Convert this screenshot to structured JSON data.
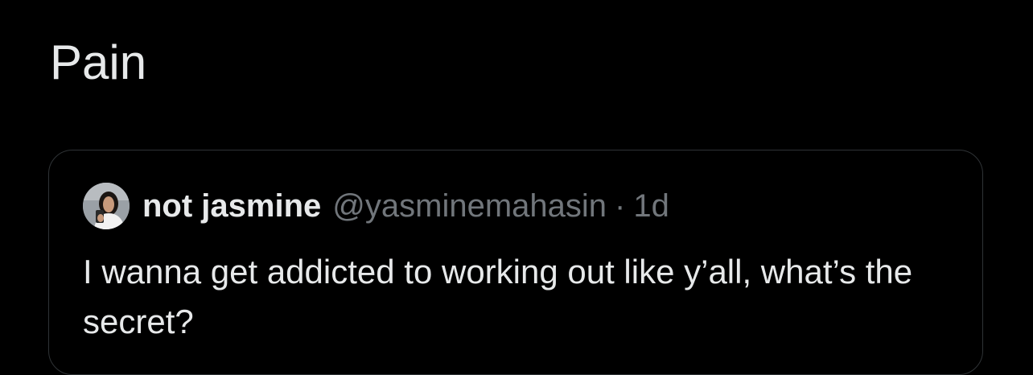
{
  "tweet": {
    "text": "Pain"
  },
  "quoted_tweet": {
    "display_name": "not jasmine",
    "handle": "@yasminemahasin",
    "separator": "·",
    "time": "1d",
    "text": "I wanna get addicted to working out like y’all, what’s the secret?",
    "avatar_icon": "profile-photo"
  },
  "colors": {
    "background": "#000000",
    "primary_text": "#e7e9ea",
    "secondary_text": "#71767b",
    "border": "#2f3336"
  }
}
